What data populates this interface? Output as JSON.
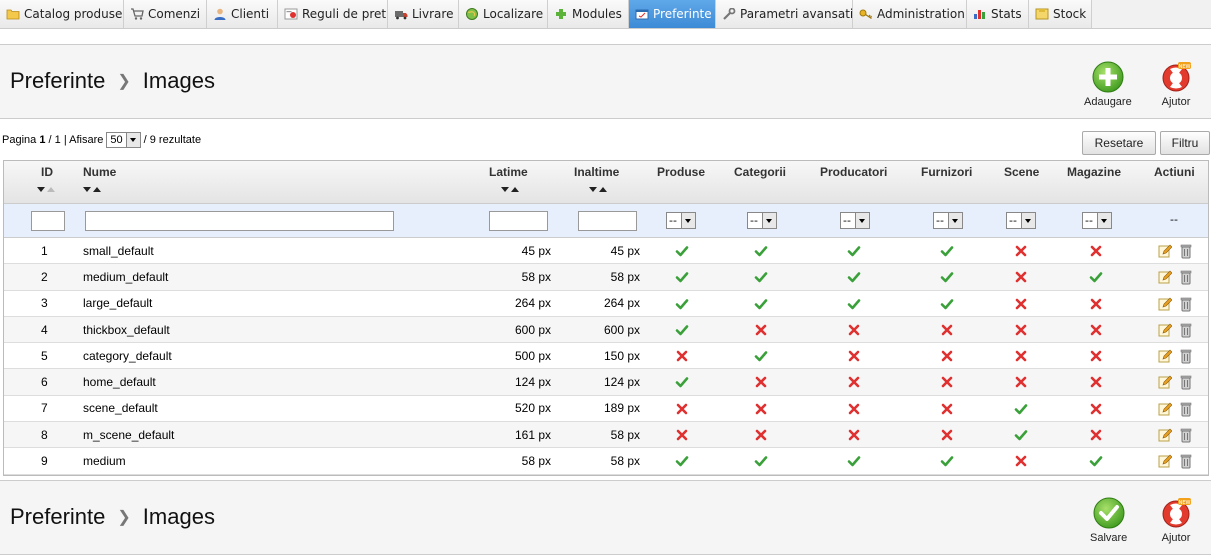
{
  "nav": {
    "tabs": [
      {
        "label": "Catalog produse",
        "icon": "folder-icon",
        "active": false
      },
      {
        "label": "Comenzi",
        "icon": "cart-icon",
        "active": false
      },
      {
        "label": "Clienti",
        "icon": "user-icon",
        "active": false
      },
      {
        "label": "Reguli de pret",
        "icon": "price-rules-icon",
        "active": false
      },
      {
        "label": "Livrare",
        "icon": "truck-icon",
        "active": false
      },
      {
        "label": "Localizare",
        "icon": "globe-icon",
        "active": false
      },
      {
        "label": "Modules",
        "icon": "puzzle-icon",
        "active": false
      },
      {
        "label": "Preferinte",
        "icon": "preferences-icon",
        "active": true
      },
      {
        "label": "Parametri avansati",
        "icon": "wrench-icon",
        "active": false
      },
      {
        "label": "Administration",
        "icon": "key-icon",
        "active": false
      },
      {
        "label": "Stats",
        "icon": "bar-chart-icon",
        "active": false
      },
      {
        "label": "Stock",
        "icon": "box-icon",
        "active": false
      }
    ]
  },
  "header": {
    "section": "Preferinte",
    "page": "Images",
    "add_label": "Adaugare",
    "help_label": "Ajutor"
  },
  "footer_header": {
    "section": "Preferinte",
    "page": "Images",
    "save_label": "Salvare",
    "help_label": "Ajutor"
  },
  "pagination": {
    "page_prefix": "Pagina",
    "current": "1",
    "sep": "/",
    "total": "1",
    "show_label": "| Afisare",
    "per_page": "50",
    "results": "/ 9 rezultate"
  },
  "buttons": {
    "reset": "Resetare",
    "filter": "Filtru"
  },
  "columns": {
    "id": "ID",
    "name": "Nume",
    "width": "Latime",
    "height": "Inaltime",
    "products": "Produse",
    "categories": "Categorii",
    "manufacturers": "Producatori",
    "suppliers": "Furnizori",
    "scenes": "Scene",
    "stores": "Magazine",
    "actions": "Actiuni"
  },
  "filters": {
    "select_value": "--",
    "actions_placeholder": "--"
  },
  "colors": {
    "check": "#3aa03a",
    "cross": "#e03030",
    "active_tab": "#4a96dc"
  },
  "rows": [
    {
      "id": "1",
      "name": "small_default",
      "width": "45 px",
      "height": "45 px",
      "flags": [
        1,
        1,
        1,
        1,
        0,
        0
      ]
    },
    {
      "id": "2",
      "name": "medium_default",
      "width": "58 px",
      "height": "58 px",
      "flags": [
        1,
        1,
        1,
        1,
        0,
        1
      ]
    },
    {
      "id": "3",
      "name": "large_default",
      "width": "264 px",
      "height": "264 px",
      "flags": [
        1,
        1,
        1,
        1,
        0,
        0
      ]
    },
    {
      "id": "4",
      "name": "thickbox_default",
      "width": "600 px",
      "height": "600 px",
      "flags": [
        1,
        0,
        0,
        0,
        0,
        0
      ]
    },
    {
      "id": "5",
      "name": "category_default",
      "width": "500 px",
      "height": "150 px",
      "flags": [
        0,
        1,
        0,
        0,
        0,
        0
      ]
    },
    {
      "id": "6",
      "name": "home_default",
      "width": "124 px",
      "height": "124 px",
      "flags": [
        1,
        0,
        0,
        0,
        0,
        0
      ]
    },
    {
      "id": "7",
      "name": "scene_default",
      "width": "520 px",
      "height": "189 px",
      "flags": [
        0,
        0,
        0,
        0,
        1,
        0
      ]
    },
    {
      "id": "8",
      "name": "m_scene_default",
      "width": "161 px",
      "height": "58 px",
      "flags": [
        0,
        0,
        0,
        0,
        1,
        0
      ]
    },
    {
      "id": "9",
      "name": "medium",
      "width": "58 px",
      "height": "58 px",
      "flags": [
        1,
        1,
        1,
        1,
        0,
        1
      ]
    }
  ]
}
